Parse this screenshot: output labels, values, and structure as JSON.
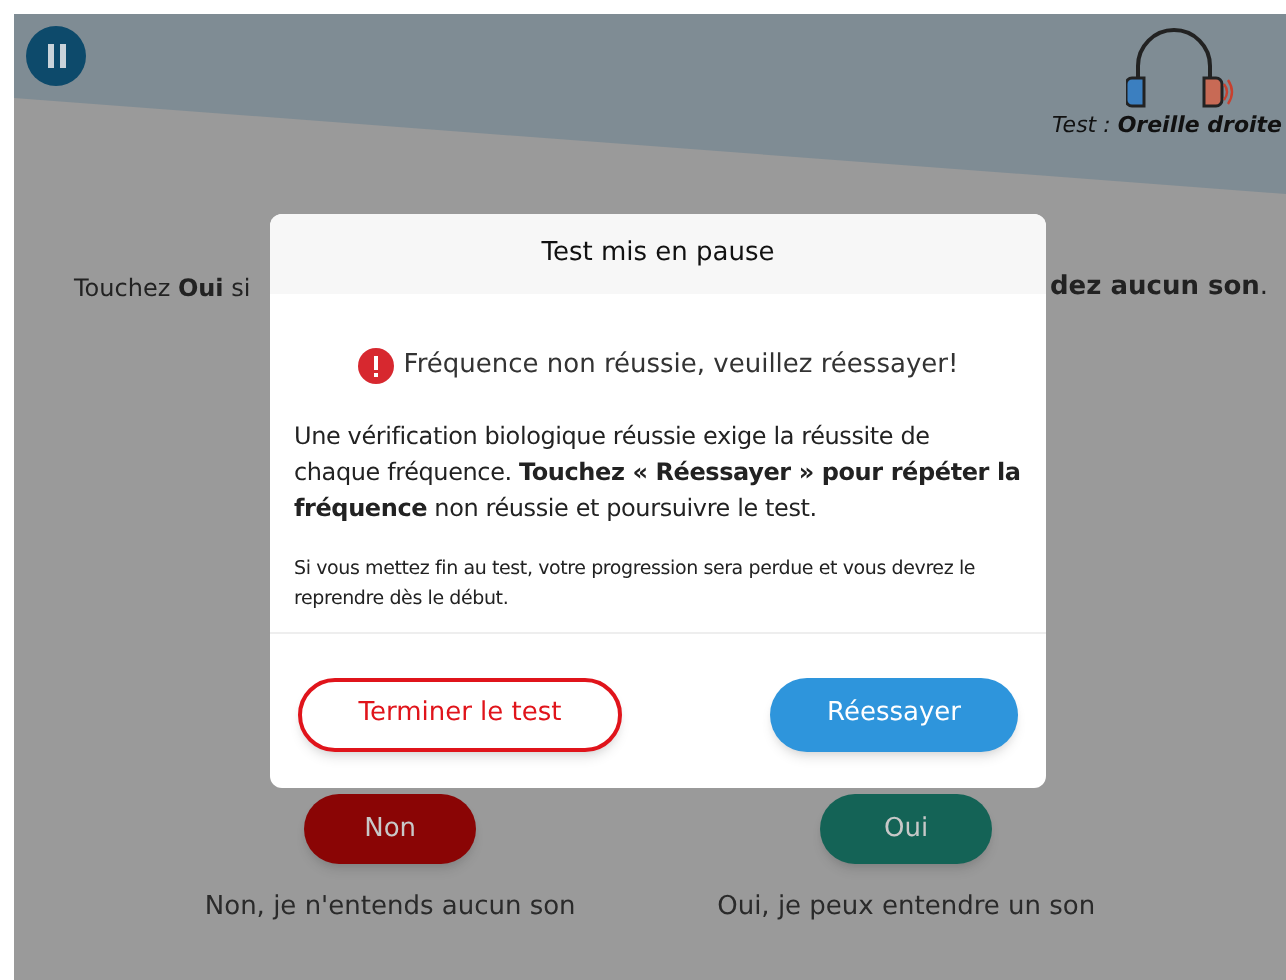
{
  "header": {
    "test_label": "Test : **Oreille droite**"
  },
  "question": {
    "hint_left": "Touchez **Oui** si",
    "hint_right": "**dez aucun son**."
  },
  "answers": [
    {
      "kind": "no",
      "label": "Non",
      "caption": "Non, je n'entends aucun son"
    },
    {
      "kind": "yes",
      "label": "Oui",
      "caption": "Oui, je peux entendre un son"
    }
  ],
  "dialog": {
    "title": "Test mis en pause",
    "error": "Fréquence non réussie, veuillez réessayer!",
    "body": "Une vérification biologique réussie exige la réussite de chaque fréquence. **Touchez « Réessayer » pour répéter la fréquence** non réussie et poursuivre le test.",
    "note": "Si vous mettez fin au test, votre progression sera perdue et vous devrez le reprendre dès le début.",
    "buttons": [
      {
        "kind": "outline",
        "label": "Terminer le test"
      },
      {
        "kind": "primary",
        "label": "Réessayer"
      }
    ]
  }
}
